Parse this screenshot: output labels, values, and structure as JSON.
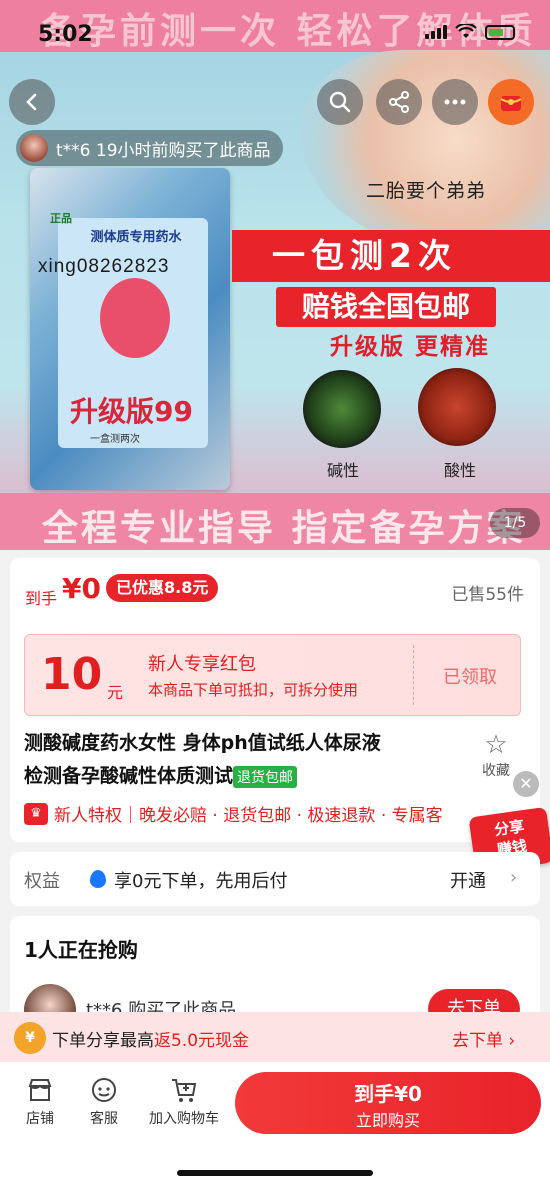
{
  "status": {
    "time": "5:02"
  },
  "hero": {
    "banner_top": "备孕前测一次 轻松了解体质",
    "banner_bottom": "全程专业指导 指定备孕方案",
    "buyer_toast": "t**6 19小时前购买了此商品",
    "second_child": "二胎要个弟弟",
    "big_red": "一包测2次",
    "red2": "赔钱全国包邮",
    "upgrade_text": "升级版 更精准",
    "alkaline_label": "碱性",
    "acid_label": "酸性",
    "packet_tag": "正品",
    "packet_title": "测体质专用药水",
    "packet_version": "升级版99",
    "packet_small": "一盒测两次",
    "watermark": "xing08262823",
    "page_indicator": "1/5"
  },
  "price": {
    "label": "到手",
    "value": "¥0",
    "discount": "已优惠8.8元",
    "sold": "已售55件"
  },
  "coupon": {
    "amount": "10",
    "unit": "元",
    "title": "新人专享红包",
    "desc": "本商品下单可抵扣，可拆分使用",
    "status": "已领取"
  },
  "product": {
    "title_line1": "测酸碱度药水女性 身体ph值试纸人体尿液",
    "title_line2": "检测备孕酸碱性体质测试",
    "return_tag": "退货包邮",
    "favorite": "收藏",
    "perks": "新人特权｜晚发必赔 · 退货包邮 · 极速退款 · 专属客",
    "crown": "♛"
  },
  "share_bubble": {
    "line1": "分享",
    "line2": "赚钱"
  },
  "rights": {
    "label": "权益",
    "text": "享0元下单，先用后付",
    "action": "开通"
  },
  "rush": {
    "title": "1人正在抢购",
    "buyer": "t**6 购买了此商品",
    "button": "去下单"
  },
  "promo": {
    "text_prefix": "下单分享最高",
    "text_highlight": "返5.0元现金",
    "action": "去下单 ›"
  },
  "bottom": {
    "tabs": [
      "店铺",
      "客服",
      "加入购物车"
    ],
    "buy_line1": "到手¥0",
    "buy_line2": "立即购买"
  }
}
